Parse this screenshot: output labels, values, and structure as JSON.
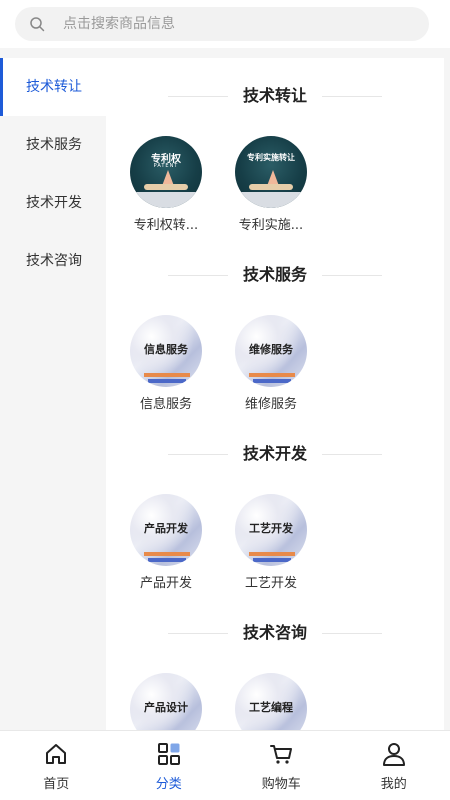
{
  "search": {
    "placeholder": "点击搜索商品信息"
  },
  "sidebar": {
    "items": [
      {
        "label": "技术转让",
        "active": true
      },
      {
        "label": "技术服务"
      },
      {
        "label": "技术开发"
      },
      {
        "label": "技术咨询"
      }
    ]
  },
  "sections": [
    {
      "title": "技术转让",
      "items": [
        {
          "name": "专利权转...",
          "thumb_text": "专利权",
          "thumb_sub": "PATENT"
        },
        {
          "name": "专利实施...",
          "thumb_text": "专利实施转让",
          "thumb_sub": ""
        }
      ]
    },
    {
      "title": "技术服务",
      "items": [
        {
          "name": "信息服务",
          "thumb_text": "信息服务"
        },
        {
          "name": "维修服务",
          "thumb_text": "维修服务"
        }
      ]
    },
    {
      "title": "技术开发",
      "items": [
        {
          "name": "产品开发",
          "thumb_text": "产品开发"
        },
        {
          "name": "工艺开发",
          "thumb_text": "工艺开发"
        }
      ]
    },
    {
      "title": "技术咨询",
      "items": [
        {
          "name": "",
          "thumb_text": "产品设计"
        },
        {
          "name": "",
          "thumb_text": "工艺编程"
        }
      ]
    }
  ],
  "tabbar": {
    "items": [
      {
        "label": "首页",
        "icon": "home-icon"
      },
      {
        "label": "分类",
        "icon": "category-icon",
        "active": true
      },
      {
        "label": "购物车",
        "icon": "cart-icon"
      },
      {
        "label": "我的",
        "icon": "user-icon"
      }
    ]
  },
  "colors": {
    "accent": "#1e5bd8"
  }
}
